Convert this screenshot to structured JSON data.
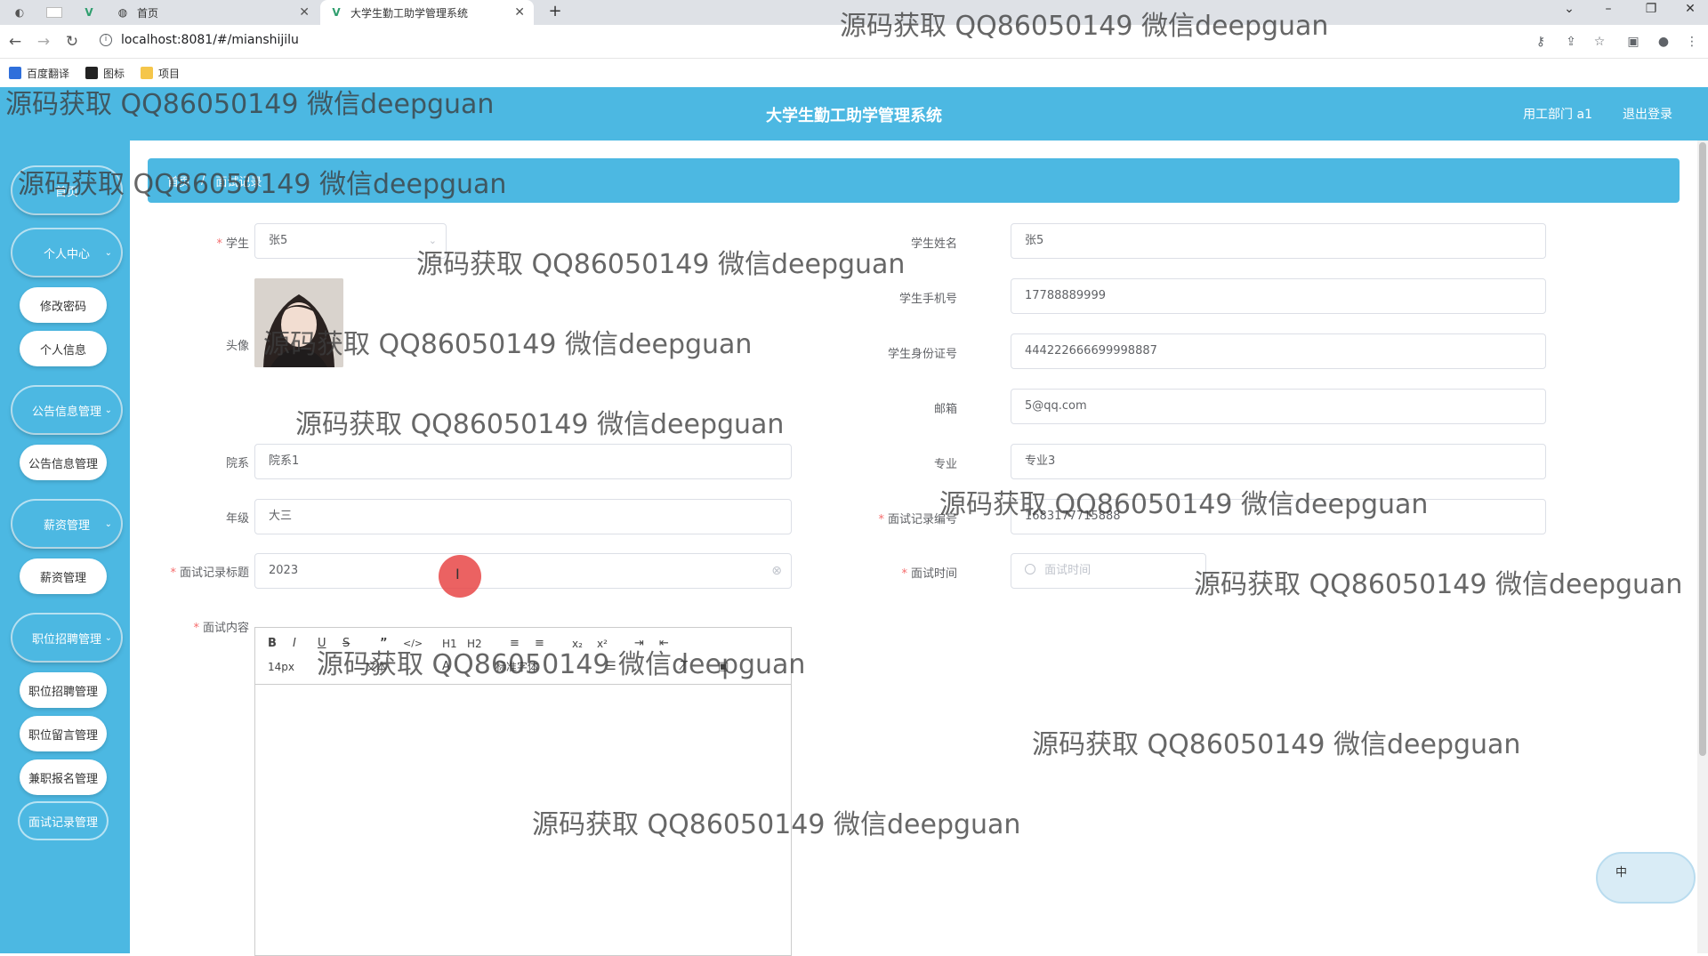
{
  "browser": {
    "tabs": [
      {
        "title": "首页"
      },
      {
        "title": "大学生勤工助学管理系统"
      }
    ],
    "url": "localhost:8081/#/mianshijilu",
    "bookmarks": [
      "百度翻译",
      "图标",
      "项目"
    ]
  },
  "header": {
    "title": "大学生勤工助学管理系统",
    "user": "用工部门 a1",
    "logout": "退出登录"
  },
  "sidebar": {
    "home": "首页",
    "groups": [
      {
        "label": "个人中心",
        "items": [
          "修改密码",
          "个人信息"
        ]
      },
      {
        "label": "公告信息管理",
        "items": [
          "公告信息管理"
        ]
      },
      {
        "label": "薪资管理",
        "items": [
          "薪资管理"
        ]
      },
      {
        "label": "职位招聘管理",
        "items": [
          "职位招聘管理",
          "职位留言管理",
          "兼职报名管理",
          "面试记录管理"
        ]
      }
    ]
  },
  "breadcrumb": [
    "首页",
    "面试记录"
  ],
  "form": {
    "student": {
      "label": "学生",
      "value": "张5"
    },
    "avatar": {
      "label": "头像"
    },
    "college": {
      "label": "院系",
      "value": "院系1"
    },
    "grade": {
      "label": "年级",
      "value": "大三"
    },
    "record_title": {
      "label": "面试记录标题",
      "value": "2023"
    },
    "content": {
      "label": "面试内容"
    },
    "student_name": {
      "label": "学生姓名",
      "value": "张5"
    },
    "phone": {
      "label": "学生手机号",
      "value": "17788889999"
    },
    "id_card": {
      "label": "学生身份证号",
      "value": "444222666699998887"
    },
    "email": {
      "label": "邮箱",
      "value": "5@qq.com"
    },
    "major": {
      "label": "专业",
      "value": "专业3"
    },
    "record_no": {
      "label": "面试记录编号",
      "value": "1683177715888"
    },
    "interview_time": {
      "label": "面试时间",
      "placeholder": "面试时间"
    }
  },
  "editor": {
    "buttons": [
      "B",
      "I",
      "U",
      "S",
      "”",
      "</>",
      "H1",
      "H2",
      "≡",
      "≡",
      "x₂",
      "x²",
      "⇥",
      "⇤",
      "⟵",
      "⟶"
    ],
    "font_size": "14px",
    "text_label": "文本",
    "font_label": "标准字体"
  },
  "ime": {
    "label": "中"
  },
  "watermark": "源码获取 QQ86050149 微信deepguan"
}
